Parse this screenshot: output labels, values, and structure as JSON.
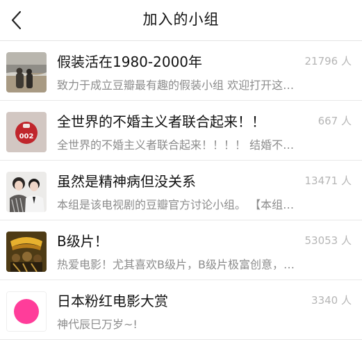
{
  "header": {
    "title": "加入的小组",
    "back_icon": "chevron-left-icon"
  },
  "groups": [
    {
      "name": "假装活在1980-2000年",
      "count": "21796 人",
      "description": "致力于成立豆瓣最有趣的假装小组 欢迎打开这…",
      "thumb": "beach-photo"
    },
    {
      "name": "全世界的不婚主义者联合起来！！",
      "count": "667 人",
      "description": "全世界的不婚主义者联合起来！！！！ 结婚不…",
      "thumb": "red-badge-002",
      "badge_text": "002"
    },
    {
      "name": "虽然是精神病但没关系",
      "count": "13471 人",
      "description": "本组是该电视剧的豆瓣官方讨论小组。 【本组…",
      "thumb": "drama-poster"
    },
    {
      "name": "B级片！",
      "count": "53053 人",
      "description": "热爱电影！尤其喜欢B级片，B级片极富创意，…",
      "thumb": "film-poster"
    },
    {
      "name": "日本粉红电影大赏",
      "count": "3340 人",
      "description": "神代辰巳万岁~!",
      "thumb": "pink-circle",
      "accent": "#ff3d9a"
    }
  ]
}
